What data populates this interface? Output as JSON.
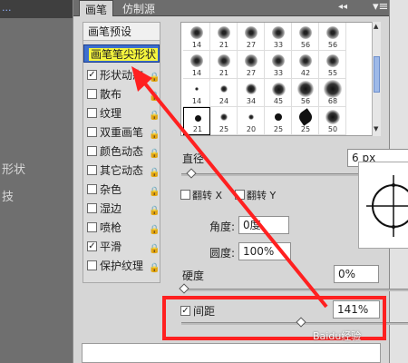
{
  "background": {
    "top_link": "...",
    "side_text_1": "形状",
    "side_text_2": "技"
  },
  "tabs": [
    {
      "label": "画笔",
      "active": true
    },
    {
      "label": "仿制源",
      "active": false
    }
  ],
  "tab_controls": {
    "arrows": "◂◂",
    "menu": "▾≡"
  },
  "left_list": {
    "header": "画笔预设",
    "selected": "画笔笔尖形状",
    "items": [
      {
        "label": "形状动态",
        "checked": true
      },
      {
        "label": "散布",
        "checked": false
      },
      {
        "label": "纹理",
        "checked": false
      },
      {
        "label": "双重画笔",
        "checked": false
      },
      {
        "label": "颜色动态",
        "checked": false
      },
      {
        "label": "其它动态",
        "checked": false
      },
      {
        "label": "杂色",
        "checked": false
      },
      {
        "label": "湿边",
        "checked": false
      },
      {
        "label": "喷枪",
        "checked": false
      },
      {
        "label": "平滑",
        "checked": true
      },
      {
        "label": "保护纹理",
        "checked": false
      }
    ]
  },
  "brush_presets": [
    {
      "size": "14",
      "kind": "spatter"
    },
    {
      "size": "21",
      "kind": "spatter"
    },
    {
      "size": "27",
      "kind": "spatter"
    },
    {
      "size": "33",
      "kind": "spatter"
    },
    {
      "size": "56",
      "kind": "spatter"
    },
    {
      "size": "56",
      "kind": "spatter"
    },
    {
      "size": "14",
      "kind": "spatter"
    },
    {
      "size": "21",
      "kind": "spatter"
    },
    {
      "size": "27",
      "kind": "spatter"
    },
    {
      "size": "33",
      "kind": "spatter"
    },
    {
      "size": "42",
      "kind": "spatter"
    },
    {
      "size": "55",
      "kind": "spatter"
    },
    {
      "size": "14",
      "kind": "soft"
    },
    {
      "size": "24",
      "kind": "soft"
    },
    {
      "size": "34",
      "kind": "soft"
    },
    {
      "size": "45",
      "kind": "soft"
    },
    {
      "size": "56",
      "kind": "soft"
    },
    {
      "size": "68",
      "kind": "soft"
    },
    {
      "size": "21",
      "kind": "hard",
      "selected": true
    },
    {
      "size": "25",
      "kind": "soft"
    },
    {
      "size": "20",
      "kind": "soft"
    },
    {
      "size": "25",
      "kind": "hard"
    },
    {
      "size": "25",
      "kind": "leaf"
    },
    {
      "size": "50",
      "kind": "soft"
    }
  ],
  "controls": {
    "diameter_label": "直径",
    "diameter_value": "6 px",
    "flip_x_label": "翻转 X",
    "flip_y_label": "翻转 Y",
    "angle_label": "角度:",
    "angle_value": "0度",
    "roundness_label": "圆度:",
    "roundness_value": "100%",
    "hardness_label": "硬度",
    "hardness_value": "0%",
    "spacing_label": "间距",
    "spacing_value": "141%",
    "spacing_checked": true
  },
  "watermark": "Baidu经验",
  "annotation_color": "#ff2020"
}
